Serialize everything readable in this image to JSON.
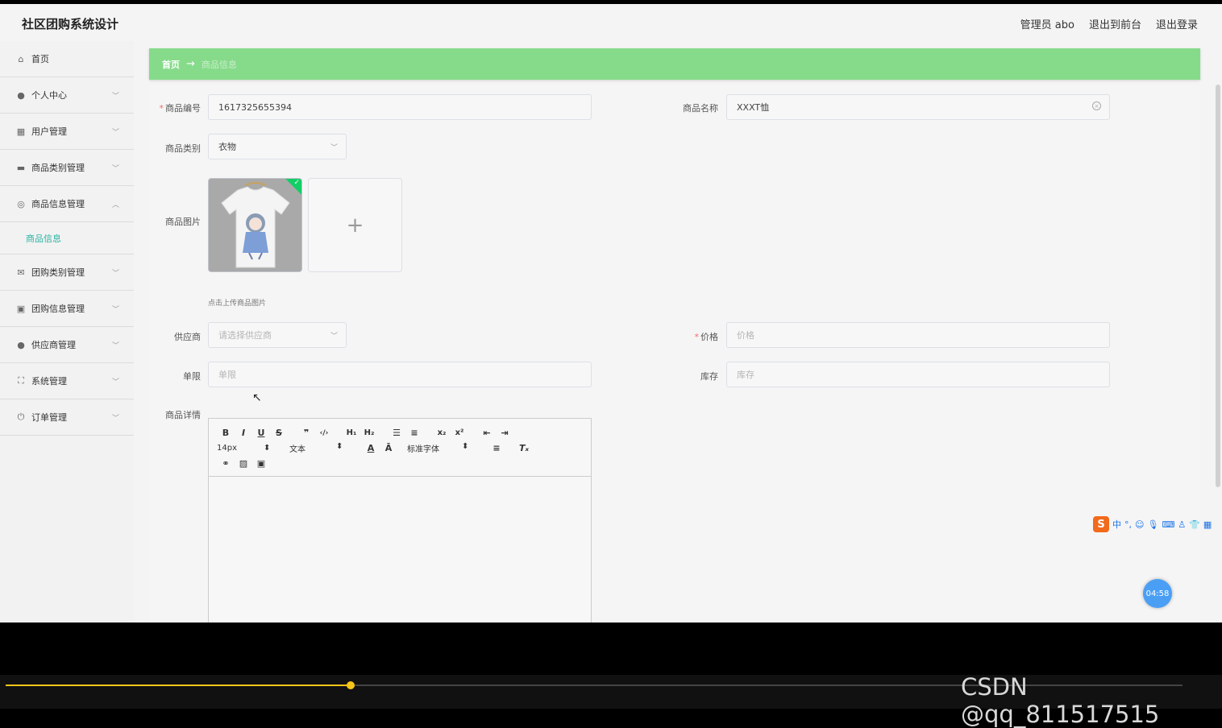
{
  "app": {
    "title": "社区团购系统设计",
    "admin_label": "管理员 abo",
    "to_front": "退出到前台",
    "logout": "退出登录"
  },
  "sidebar": {
    "items": [
      {
        "label": "首页",
        "icon": "home-icon"
      },
      {
        "label": "个人中心",
        "icon": "user-icon"
      },
      {
        "label": "用户管理",
        "icon": "chart-icon"
      },
      {
        "label": "商品类别管理",
        "icon": "briefcase-icon"
      },
      {
        "label": "商品信息管理",
        "icon": "circle-icon"
      },
      {
        "label": "团购类别管理",
        "icon": "mail-icon"
      },
      {
        "label": "团购信息管理",
        "icon": "clipboard-icon"
      },
      {
        "label": "供应商管理",
        "icon": "user-icon"
      },
      {
        "label": "系统管理",
        "icon": "expand-icon"
      },
      {
        "label": "订单管理",
        "icon": "power-icon"
      }
    ],
    "sub_item": "商品信息"
  },
  "breadcrumb": {
    "home": "首页",
    "arrow": "→",
    "current": "商品信息"
  },
  "form": {
    "product_no_label": "商品编号",
    "product_no_value": "1617325655394",
    "product_name_label": "商品名称",
    "product_name_value": "XXXT恤",
    "category_label": "商品类别",
    "category_value": "衣物",
    "image_label": "商品图片",
    "upload_hint": "点击上传商品图片",
    "supplier_label": "供应商",
    "supplier_placeholder": "请选择供应商",
    "price_label": "价格",
    "price_placeholder": "价格",
    "limit_label": "单限",
    "limit_placeholder": "单限",
    "stock_label": "库存",
    "stock_placeholder": "库存",
    "detail_label": "商品详情"
  },
  "editor": {
    "font_size": "14px",
    "text_type": "文本",
    "font_family": "标准字体"
  },
  "ime": {
    "lang": "中"
  },
  "timer": "04:58",
  "watermark": "CSDN @qq_811517515",
  "player": {
    "progress": 0.293
  }
}
